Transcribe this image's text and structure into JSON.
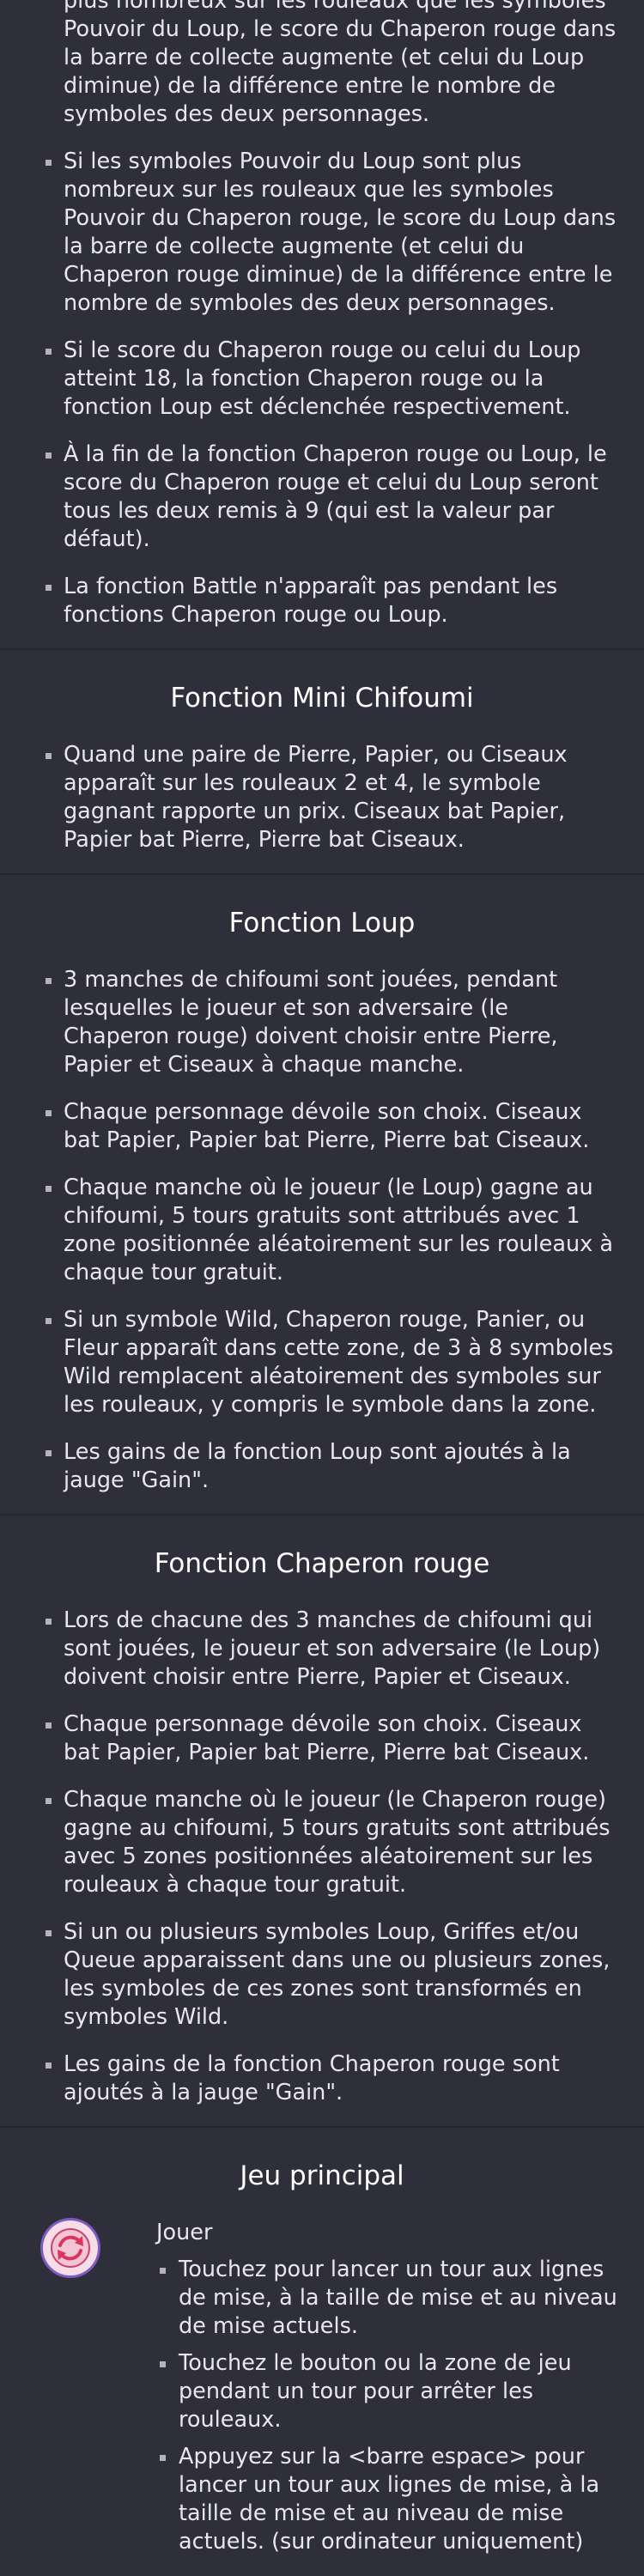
{
  "sections": [
    {
      "title": "",
      "items": [
        "Si les symboles Pouvoir du Chaperon rouge sont plus nombreux sur les rouleaux que les symboles Pouvoir du Loup, le score du Chaperon rouge dans la barre de collecte augmente (et celui du Loup diminue) de la différence entre le nombre de symboles des deux personnages.",
        "Si les symboles Pouvoir du Loup sont plus nombreux sur les rouleaux que les symboles Pouvoir du Chaperon rouge, le score du Loup dans la barre de collecte augmente (et celui du Chaperon rouge diminue) de la différence entre le nombre de symboles des deux personnages.",
        "Si le score du Chaperon rouge ou celui du Loup atteint 18, la fonction Chaperon rouge ou la fonction Loup est déclenchée respectivement.",
        "À la fin de la fonction Chaperon rouge ou Loup, le score du Chaperon rouge et celui du Loup seront tous les deux remis à 9 (qui est la valeur par défaut).",
        "La fonction Battle n'apparaît pas pendant les fonctions Chaperon rouge ou Loup."
      ]
    },
    {
      "title": "Fonction Mini Chifoumi",
      "items": [
        "Quand une paire de Pierre, Papier, ou Ciseaux apparaît sur les rouleaux 2 et 4, le symbole gagnant rapporte un prix. Ciseaux bat Papier, Papier bat Pierre, Pierre bat Ciseaux."
      ]
    },
    {
      "title": "Fonction Loup",
      "items": [
        "3 manches de chifoumi sont jouées, pendant lesquelles le joueur et son adversaire (le Chaperon rouge) doivent choisir entre Pierre, Papier et Ciseaux à chaque manche.",
        "Chaque personnage dévoile son choix. Ciseaux bat Papier, Papier bat Pierre, Pierre bat Ciseaux.",
        "Chaque manche où le joueur (le Loup) gagne au chifoumi, 5 tours gratuits sont attribués avec 1 zone positionnée aléatoirement sur les rouleaux à chaque tour gratuit.",
        "Si un symbole Wild, Chaperon rouge, Panier, ou Fleur apparaît dans cette zone, de 3 à 8 symboles Wild remplacent aléatoirement des symboles sur les rouleaux, y compris le symbole dans la zone.",
        "Les gains de la fonction Loup sont ajoutés à la jauge \"Gain\"."
      ]
    },
    {
      "title": "Fonction Chaperon rouge",
      "items": [
        "Lors de chacune des 3 manches de chifoumi qui sont jouées, le joueur et son adversaire (le Loup) doivent choisir entre Pierre, Papier et Ciseaux.",
        "Chaque personnage dévoile son choix. Ciseaux bat Papier, Papier bat Pierre, Pierre bat Ciseaux.",
        "Chaque manche où le joueur (le Chaperon rouge) gagne au chifoumi, 5 tours gratuits sont attribués avec 5 zones positionnées aléatoirement sur les rouleaux à chaque tour gratuit.",
        "Si un ou plusieurs symboles Loup, Griffes et/ou Queue apparaissent dans une ou plusieurs zones, les symboles de ces zones sont transformés en symboles Wild.",
        "Les gains de la fonction Chaperon rouge sont ajoutés à la jauge \"Gain\"."
      ]
    }
  ],
  "main_game": {
    "title": "Jeu principal",
    "play_icon": "spin-arrows-icon",
    "play_title": "Jouer",
    "items": [
      "Touchez pour lancer un tour aux lignes de mise, à la taille de mise et au niveau de mise actuels.",
      "Touchez le bouton ou la zone de jeu pendant un tour pour arrêter les rouleaux.",
      "Appuyez sur la <barre espace> pour lancer un tour aux lignes de mise, à la taille de mise et au niveau de mise actuels. (sur ordinateur uniquement)"
    ]
  },
  "colors": {
    "background": "#2f2e3b",
    "divider": "#25242f",
    "icon_bg": "#f6dde8",
    "icon_accent": "#d9365e"
  }
}
